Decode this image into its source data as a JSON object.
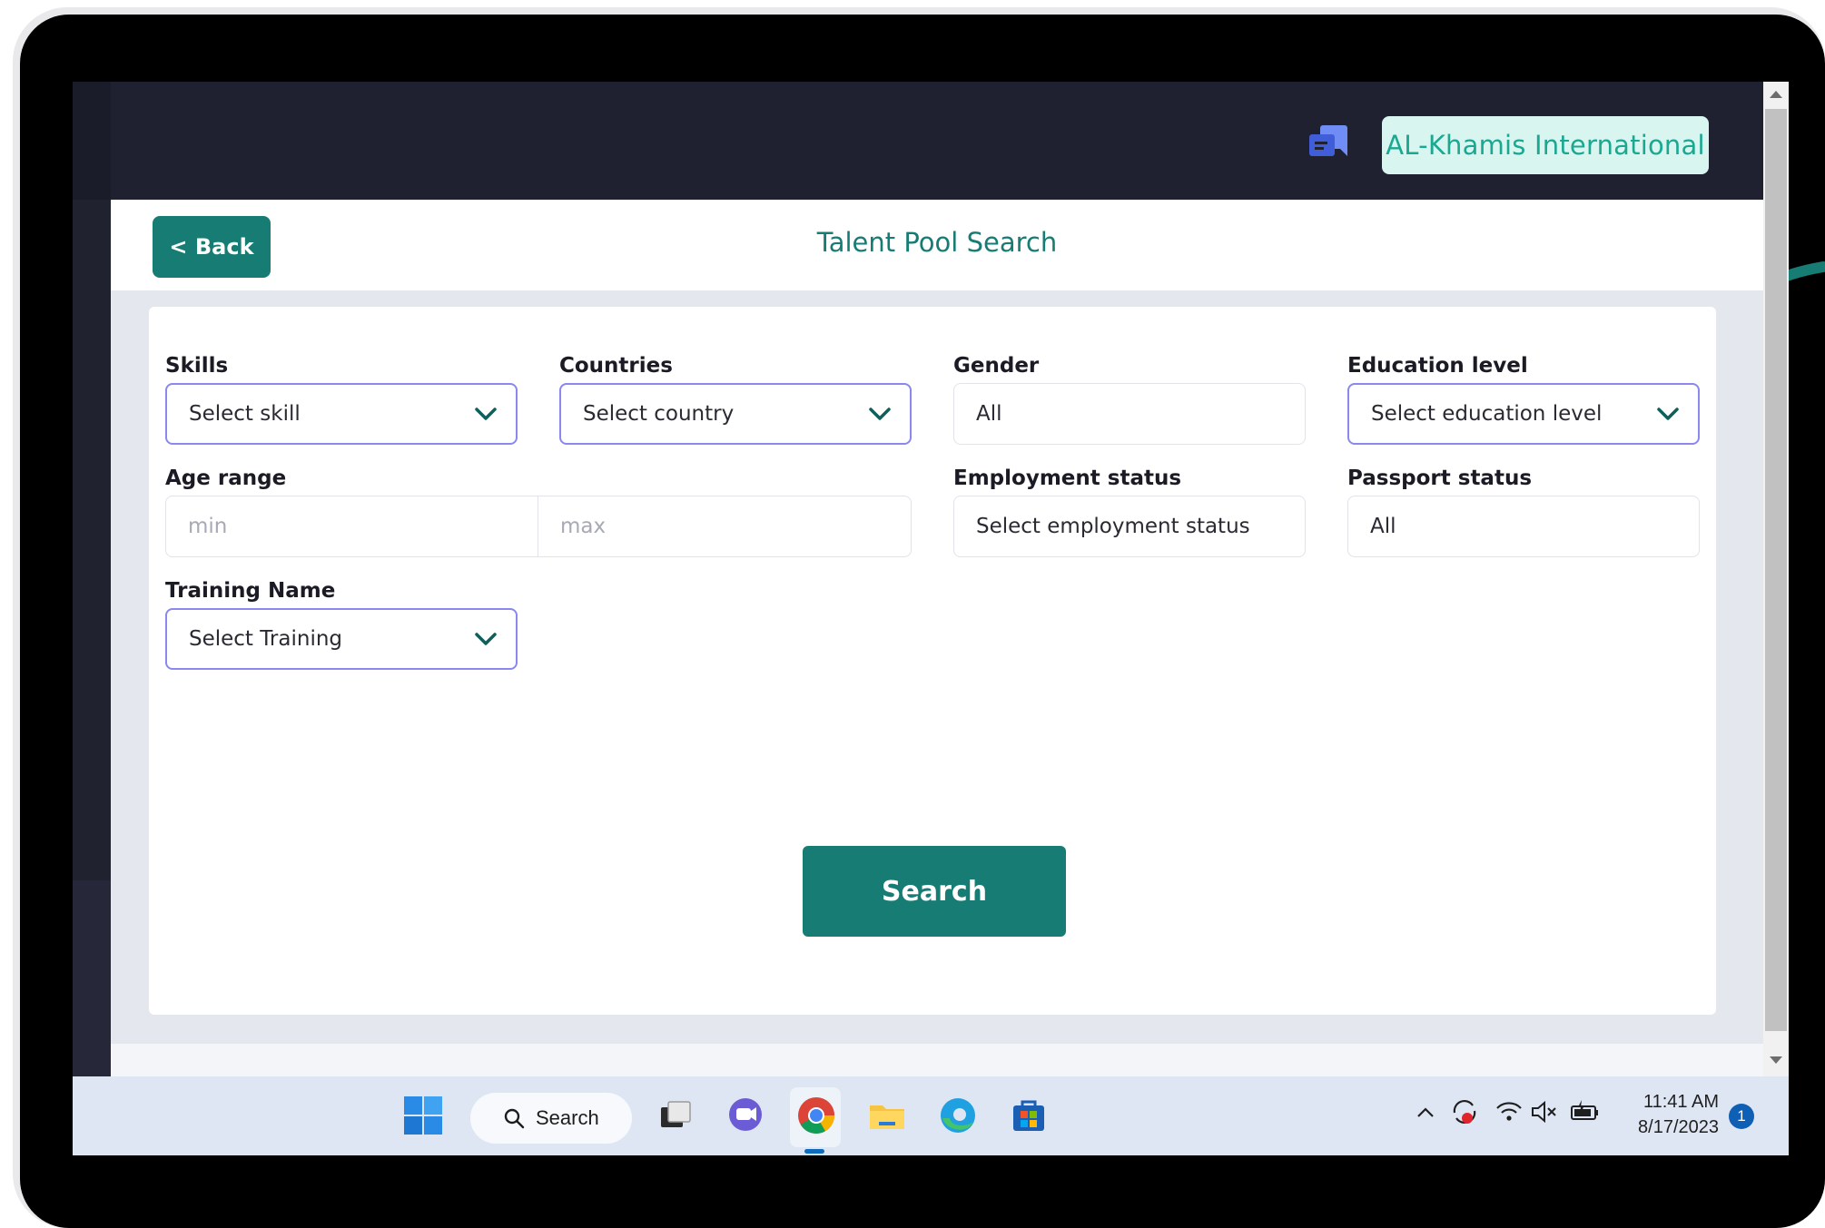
{
  "header": {
    "company_name": "AL-Khamis International",
    "chat_icon": "chat-bubbles-icon"
  },
  "page": {
    "back_label": "< Back",
    "title": "Talent Pool Search"
  },
  "filters": {
    "skills": {
      "label": "Skills",
      "value": "Select skill"
    },
    "countries": {
      "label": "Countries",
      "value": "Select country"
    },
    "gender": {
      "label": "Gender",
      "value": "All"
    },
    "education": {
      "label": "Education level",
      "value": "Select education level"
    },
    "age_range": {
      "label": "Age range",
      "min_placeholder": "min",
      "max_placeholder": "max"
    },
    "employment": {
      "label": "Employment status",
      "value": "Select employment status"
    },
    "passport": {
      "label": "Passport status",
      "value": "All"
    },
    "training": {
      "label": "Training Name",
      "value": "Select Training"
    }
  },
  "actions": {
    "search_label": "Search"
  },
  "taskbar": {
    "search_label": "Search",
    "time": "11:41 AM",
    "date": "8/17/2023",
    "notification_count": "1",
    "apps": [
      "start-icon",
      "task-view-icon",
      "chat-icon",
      "chrome-icon",
      "file-explorer-icon",
      "edge-icon",
      "store-icon"
    ]
  },
  "colors": {
    "primary": "#167c74",
    "topbar": "#1f2030",
    "select_border": "#8b87ee",
    "badge_bg": "#d8f5ef",
    "badge_text": "#1aa892"
  }
}
